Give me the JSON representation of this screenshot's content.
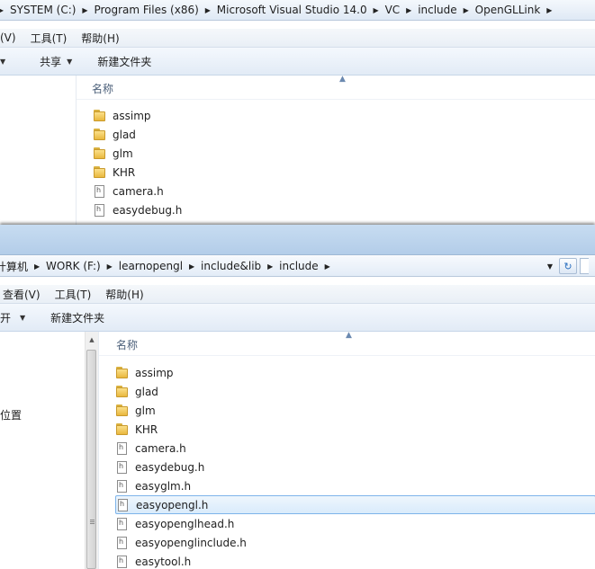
{
  "window_back": {
    "address": [
      "SYSTEM (C:)",
      "Program Files (x86)",
      "Microsoft Visual Studio 14.0",
      "VC",
      "include",
      "OpenGLLink"
    ],
    "menu": [
      "(V)",
      "工具(T)",
      "帮助(H)"
    ],
    "toolbar": {
      "share_label": "共享",
      "new_folder_label": "新建文件夹"
    },
    "column_name": "名称",
    "files": [
      {
        "name": "assimp",
        "type": "folder"
      },
      {
        "name": "glad",
        "type": "folder"
      },
      {
        "name": "glm",
        "type": "folder"
      },
      {
        "name": "KHR",
        "type": "folder"
      },
      {
        "name": "camera.h",
        "type": "header"
      },
      {
        "name": "easydebug.h",
        "type": "header"
      }
    ]
  },
  "window_front": {
    "address": [
      "计算机",
      "WORK (F:)",
      "learnopengl",
      "include&lib",
      "include"
    ],
    "menu": [
      "查看(V)",
      "工具(T)",
      "帮助(H)"
    ],
    "toolbar": {
      "open_label": "开",
      "new_folder_label": "新建文件夹"
    },
    "nav_item": "位置",
    "column_name": "名称",
    "files": [
      {
        "name": "assimp",
        "type": "folder"
      },
      {
        "name": "glad",
        "type": "folder"
      },
      {
        "name": "glm",
        "type": "folder"
      },
      {
        "name": "KHR",
        "type": "folder"
      },
      {
        "name": "camera.h",
        "type": "header"
      },
      {
        "name": "easydebug.h",
        "type": "header"
      },
      {
        "name": "easyglm.h",
        "type": "header"
      },
      {
        "name": "easyopengl.h",
        "type": "header",
        "selected": true
      },
      {
        "name": "easyopenglhead.h",
        "type": "header"
      },
      {
        "name": "easyopenglinclude.h",
        "type": "header"
      },
      {
        "name": "easytool.h",
        "type": "header"
      }
    ]
  },
  "colors": {
    "selection_border": "#7eb4ea",
    "toolbar": "#e2ebf6"
  }
}
